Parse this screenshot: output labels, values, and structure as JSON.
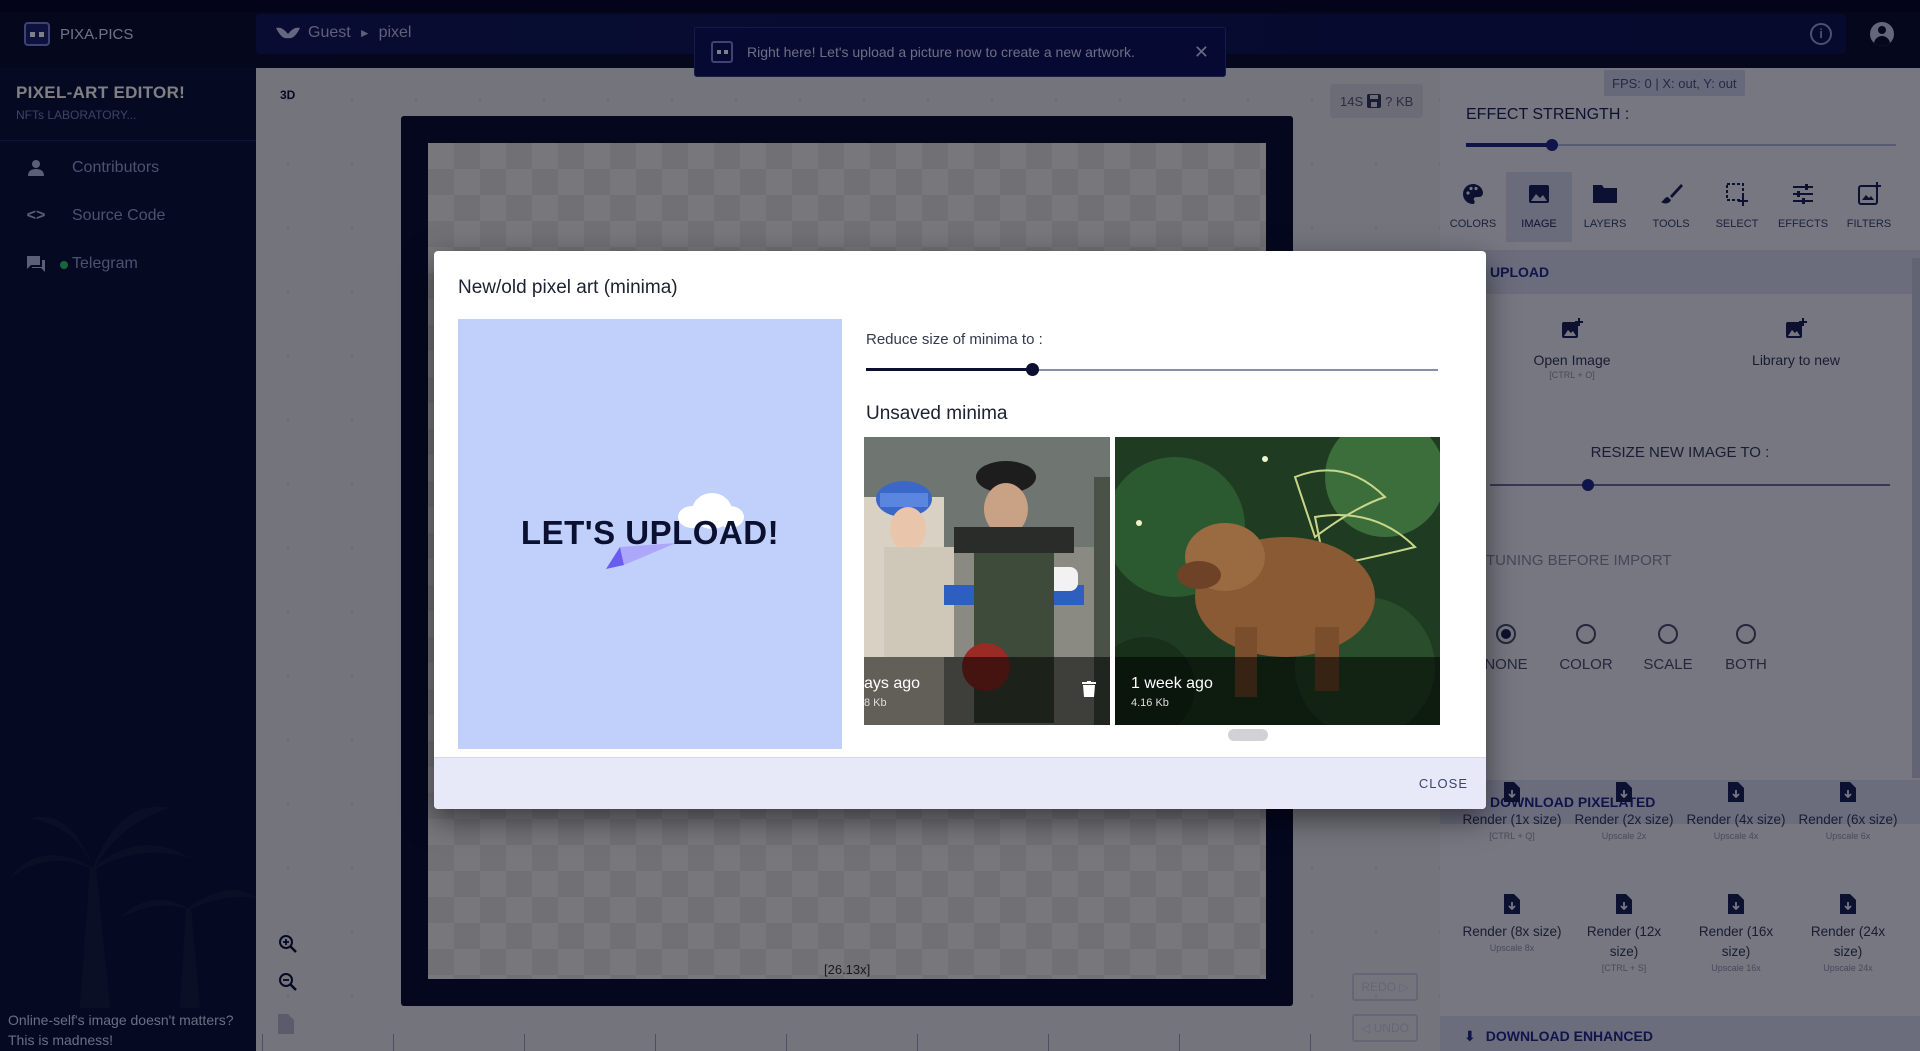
{
  "app": {
    "logo_text": "PIXA.PICS"
  },
  "address": {
    "user": "Guest",
    "separator": "►",
    "page": "pixel"
  },
  "toast": {
    "message": "Right here! Let's upload a picture now to create a new artwork.",
    "close_glyph": "✕"
  },
  "sidebar": {
    "title": "PIXEL-ART EDITOR!",
    "subtitle": "NFTs LABORATORY...",
    "items": [
      {
        "label": "Contributors",
        "icon": "person-icon"
      },
      {
        "label": "Source Code",
        "icon": "code-icon"
      },
      {
        "label": "Telegram",
        "icon": "chat-icon"
      }
    ],
    "footer": "Online-self's image doesn't matters? This is madness!"
  },
  "workspace": {
    "mode_3d": "3D",
    "size_prefix": "14S",
    "size_suffix": "? KB",
    "zoom_label": "[26.13x]",
    "redo_label": "REDO",
    "undo_label": "UNDO"
  },
  "panel": {
    "fps": "FPS: 0 | X: out, Y: out",
    "effect_strength_label": "EFFECT STRENGTH :",
    "effect_strength_fraction": 0.2,
    "tabs": [
      {
        "label": "COLORS",
        "icon": "palette-icon"
      },
      {
        "label": "IMAGE",
        "icon": "image-icon",
        "active": true
      },
      {
        "label": "LAYERS",
        "icon": "folder-icon"
      },
      {
        "label": "TOOLS",
        "icon": "brush-icon"
      },
      {
        "label": "SELECT",
        "icon": "select-icon"
      },
      {
        "label": "EFFECTS",
        "icon": "sliders-icon"
      },
      {
        "label": "FILTERS",
        "icon": "filter-icon"
      }
    ],
    "upload_header": "UPLOAD",
    "open_image": {
      "label": "Open Image",
      "shortcut": "[CTRL + O]"
    },
    "library": {
      "label": "Library to new"
    },
    "resize_label": "RESIZE NEW IMAGE TO :",
    "resize_fraction": 0.245,
    "tuning_label": "TUNING BEFORE IMPORT",
    "tuning_options": [
      {
        "label": "NONE",
        "selected": true
      },
      {
        "label": "COLOR",
        "selected": false
      },
      {
        "label": "SCALE",
        "selected": false
      },
      {
        "label": "BOTH",
        "selected": false
      }
    ],
    "download_pixelated_header": "DOWNLOAD PIXELATED",
    "renders": [
      {
        "label": "Render (1x size)",
        "hint": "[CTRL + Q]"
      },
      {
        "label": "Render (2x size)",
        "hint": "Upscale 2x"
      },
      {
        "label": "Render (4x size)",
        "hint": "Upscale 4x"
      },
      {
        "label": "Render (6x size)",
        "hint": "Upscale 6x"
      },
      {
        "label": "Render (8x size)",
        "hint": "Upscale 8x"
      },
      {
        "label": "Render (12x size)",
        "hint": "[CTRL + S]"
      },
      {
        "label": "Render (16x size)",
        "hint": "Upscale 16x"
      },
      {
        "label": "Render (24x size)",
        "hint": "Upscale 24x"
      }
    ],
    "download_enhanced_header": "DOWNLOAD ENHANCED"
  },
  "dialog": {
    "title": "New/old pixel art (minima)",
    "upload_text": "LET'S UPLOAD!",
    "reduce_label": "Reduce size of minima to :",
    "reduce_fraction": 0.29,
    "unsaved_label": "Unsaved minima",
    "minima": [
      {
        "time": "ays ago",
        "size": "8 Kb"
      },
      {
        "time": "1 week ago",
        "size": "4.16 Kb"
      }
    ],
    "close_label": "CLOSE"
  }
}
